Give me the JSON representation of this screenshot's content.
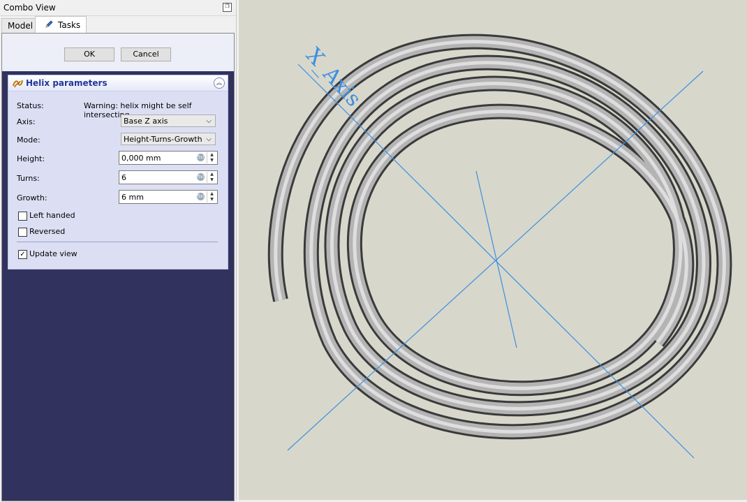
{
  "combo": {
    "title": "Combo View",
    "float_icon": "restore-window-icon",
    "tabs": [
      {
        "label": "Model",
        "active": false
      },
      {
        "label": "Tasks",
        "active": true,
        "icon": "pencil-icon"
      }
    ]
  },
  "task": {
    "ok_label": "OK",
    "cancel_label": "Cancel"
  },
  "helix": {
    "title": "Helix parameters",
    "title_icon": "helix-icon",
    "collapse_icon": "collapse-up-icon",
    "status_label": "Status:",
    "status_value": "Warning: helix might be self intersecting",
    "axis_label": "Axis:",
    "axis_value": "Base Z axis",
    "mode_label": "Mode:",
    "mode_value": "Height-Turns-Growth",
    "height_label": "Height:",
    "height_value": "0,000 mm",
    "turns_label": "Turns:",
    "turns_value": "6",
    "growth_label": "Growth:",
    "growth_value": "6 mm",
    "left_handed_label": "Left handed",
    "left_handed": false,
    "reversed_label": "Reversed",
    "reversed": false,
    "update_view_label": "Update view",
    "update_view": true
  },
  "viewport": {
    "background": "#d8d7cb",
    "axis_color": "#3a8fe0",
    "x_axis_label": "X_Axis",
    "tube_color": "#a0a0a0"
  }
}
